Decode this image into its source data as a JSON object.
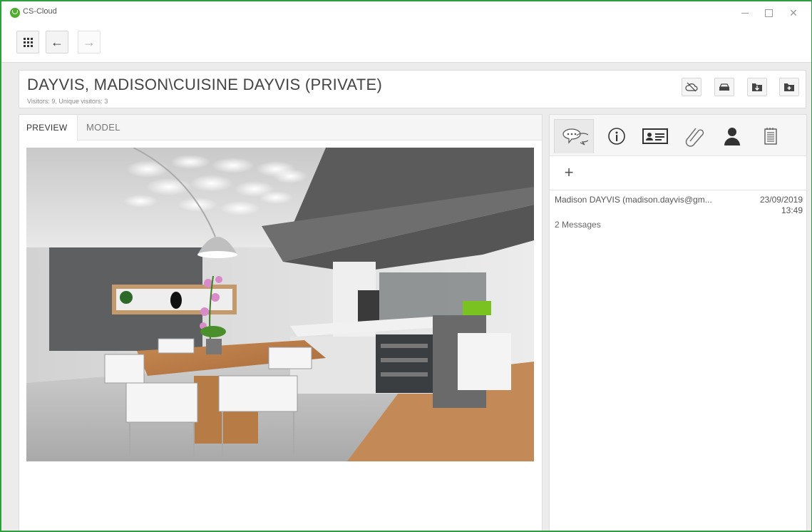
{
  "app": {
    "title": "CS-Cloud",
    "close_glyph": "✕"
  },
  "toolbar": {
    "apps_icon": "grid-icon",
    "back_label": "←",
    "forward_label": "→"
  },
  "header": {
    "title": "DAYVIS, MADISON\\CUISINE DAYVIS (PRIVATE)",
    "subtitle": "Visitors: 9, Unique visitors: 3",
    "actions": [
      "cloud-off-icon",
      "scanner-icon",
      "folder-download-icon",
      "folder-upload-icon"
    ]
  },
  "left_panel": {
    "tabs": [
      {
        "label": "PREVIEW",
        "active": true
      },
      {
        "label": "MODEL",
        "active": false
      }
    ]
  },
  "right_panel": {
    "tabs": [
      "chat-bubbles-icon",
      "info-icon",
      "contact-card-icon",
      "paperclip-icon",
      "user-icon",
      "notepad-icon"
    ],
    "add_label": "+",
    "messages": [
      {
        "from": "Madison DAYVIS (madison.dayvis@gm...",
        "date": "23/09/2019",
        "time": "13:49",
        "count": "2 Messages"
      }
    ]
  },
  "colors": {
    "window_border": "#2e9e3e",
    "app_icon": "#4fae2e"
  }
}
